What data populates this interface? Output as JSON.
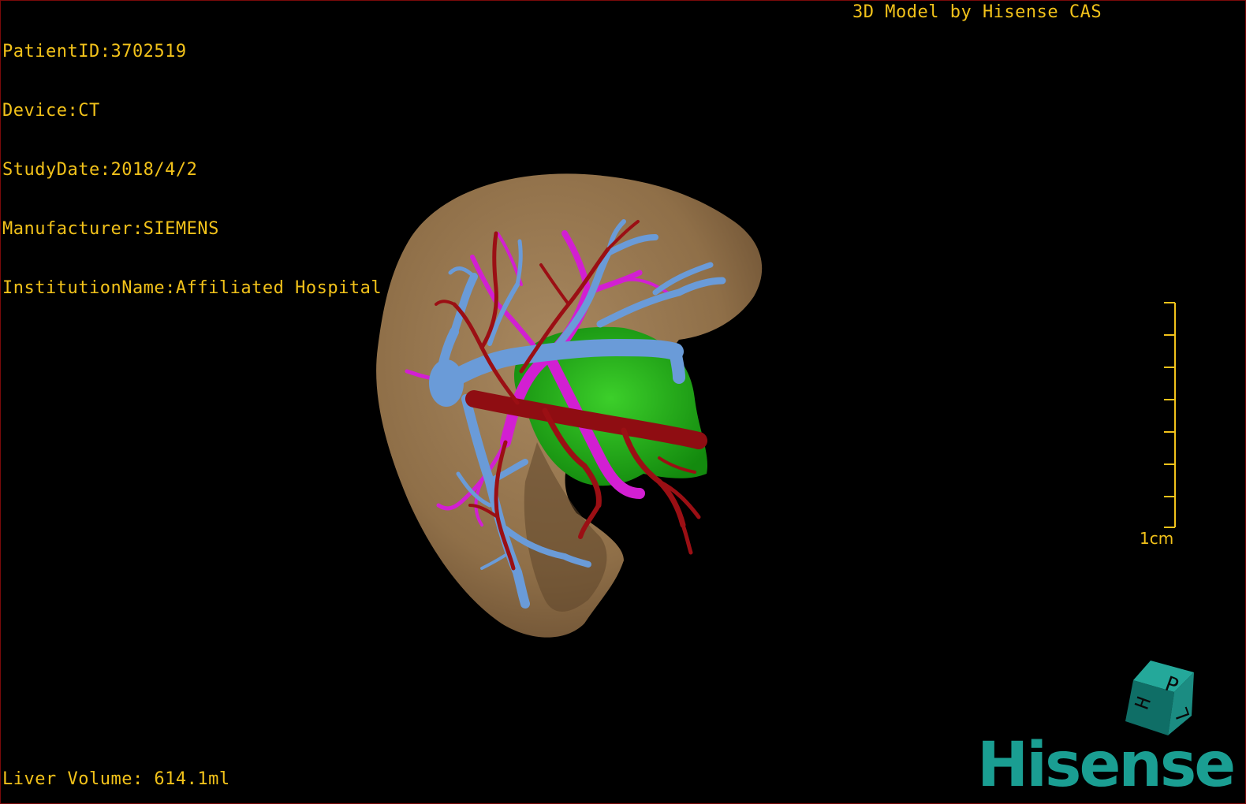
{
  "overlay": {
    "patient_id": "PatientID:3702519",
    "device": "Device:CT",
    "study_date": "StudyDate:2018/4/2",
    "manufacturer": "Manufacturer:SIEMENS",
    "institution": "InstitutionName:Affiliated Hospital Qingdao University-C",
    "credit": "3D Model by Hisense CAS",
    "liver_volume": "Liver Volume: 614.1ml"
  },
  "scale": {
    "label": "1cm"
  },
  "orientation_cube": {
    "face_top": "P",
    "face_left": "H",
    "face_right": "L"
  },
  "brand": {
    "name": "Hisense",
    "color": "#1a9e92"
  },
  "colors": {
    "overlay_text": "#f2c21a",
    "liver": "#9b7a52",
    "portal_vein": "#6a9bd8",
    "hepatic_artery": "#9b0f14",
    "hepatic_vein": "#d21fd2",
    "tumor": "#22b31a"
  }
}
